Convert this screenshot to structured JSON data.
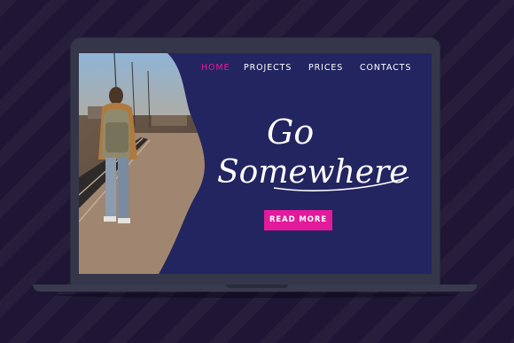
{
  "nav": {
    "items": [
      {
        "label": "HOME",
        "active": true
      },
      {
        "label": "PROJECTS",
        "active": false
      },
      {
        "label": "PRICES",
        "active": false
      },
      {
        "label": "CONTACTS",
        "active": false
      }
    ]
  },
  "hero": {
    "headline_line1": "Go",
    "headline_line2": "Somewhere",
    "cta_label": "READ MORE",
    "photo": "traveler-with-backpack-on-train-platform"
  },
  "colors": {
    "background": "#1e1634",
    "screen": "#232561",
    "accent": "#e21a9b",
    "text": "#ffffff",
    "laptop_body": "#36364a"
  }
}
